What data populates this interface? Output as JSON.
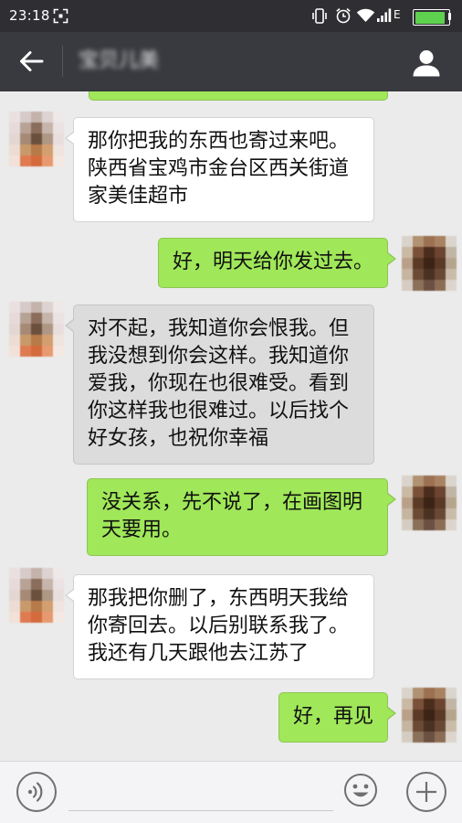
{
  "status_bar": {
    "time": "23:18",
    "network_type": "E",
    "battery_level": 0.9,
    "battery_color": "#5ed14f",
    "icons": [
      "screenshot-icon",
      "vibrate-icon",
      "alarm-icon",
      "wifi-icon",
      "signal-icon",
      "battery-icon"
    ]
  },
  "header": {
    "title": "宝贝儿美",
    "icons": [
      "back-arrow-icon",
      "person-icon"
    ]
  },
  "colors": {
    "status_bar_bg": "#2f2f33",
    "header_bg": "#393a3f",
    "chat_bg": "#ebebeb",
    "outgoing_bubble": "#a0e759",
    "incoming_bubble": "#ffffff",
    "pressed_bubble": "#dcdcdc",
    "input_bar_bg": "#f4f4f6"
  },
  "avatars": {
    "contact": {
      "mosaic": [
        [
          "#e9e0df",
          "#d6cbc9",
          "#c4b3ab",
          "#ddd3d1",
          "#efe8e8"
        ],
        [
          "#e6dbda",
          "#b7a296",
          "#8a6d5b",
          "#c6b5aa",
          "#ebe3e3"
        ],
        [
          "#e3d7d3",
          "#a68a76",
          "#6c503e",
          "#ae9785",
          "#e8dedd"
        ],
        [
          "#ecdcd3",
          "#c89a6b",
          "#b77a49",
          "#d39f70",
          "#f0e4df"
        ],
        [
          "#f2e1d8",
          "#df7b51",
          "#d46b3d",
          "#e79a70",
          "#f4e8e3"
        ]
      ]
    },
    "me": {
      "mosaic": [
        [
          "#dad3cb",
          "#b19272",
          "#9b7152",
          "#a98262",
          "#d9d5cd"
        ],
        [
          "#c9b9a5",
          "#7b5139",
          "#4b2d1d",
          "#6b4531",
          "#c1b5a5"
        ],
        [
          "#b9a189",
          "#5b3b27",
          "#3b2315",
          "#5b3927",
          "#b5a58d"
        ],
        [
          "#c5b5a1",
          "#6b4b35",
          "#4b3121",
          "#694935",
          "#c9bda9"
        ],
        [
          "#d5cdc1",
          "#8b7159",
          "#6b5141",
          "#8b6d55",
          "#ddd5cd"
        ]
      ]
    }
  },
  "messages": [
    {
      "incoming": true,
      "lines": [
        "那你把我的东西也寄过来吧。",
        "陕西省宝鸡市金台区西关街道",
        "家美佳超市"
      ]
    },
    {
      "incoming": false,
      "lines": [
        "好，明天给你发过去。"
      ]
    },
    {
      "incoming": true,
      "lines": [
        "对不起，我知道你会恨我。但",
        "我没想到你会这样。我知道你",
        "爱我，你现在也很难受。看到",
        "你这样我也很难过。以后找个",
        "好女孩，也祝你幸福"
      ]
    },
    {
      "incoming": false,
      "lines": [
        "没关系，先不说了，在画图明",
        "天要用。"
      ]
    },
    {
      "incoming": true,
      "lines": [
        "那我把你删了，东西明天我给",
        "你寄回去。以后别联系我了。",
        "我还有几天跟他去江苏了"
      ]
    },
    {
      "incoming": false,
      "lines": [
        "好，再见"
      ]
    }
  ],
  "input_bar": {
    "value": "",
    "icons": [
      "voice-icon",
      "emoji-icon",
      "plus-icon"
    ]
  }
}
